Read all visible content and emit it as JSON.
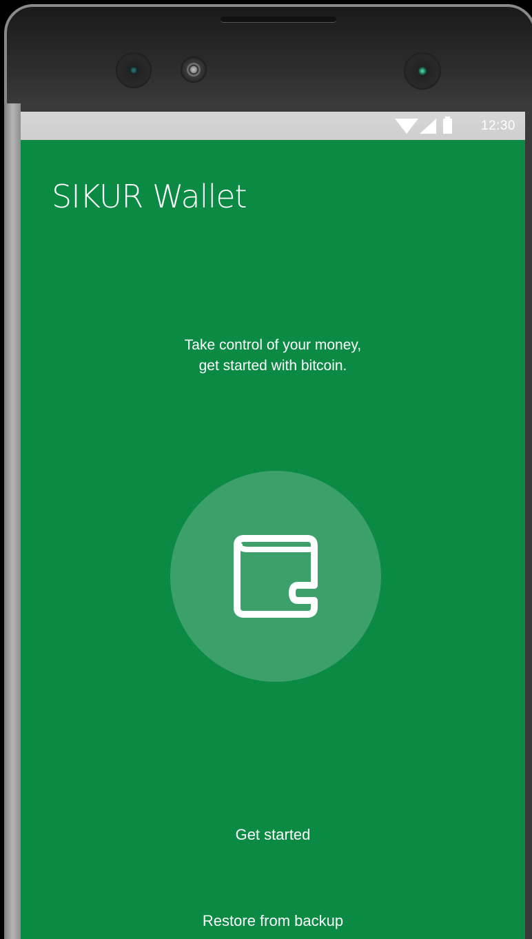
{
  "status_bar": {
    "time": "12:30",
    "icons": [
      "wifi-icon",
      "signal-icon",
      "battery-icon"
    ]
  },
  "app": {
    "title": "SIKUR Wallet",
    "tagline_line1": "Take control of your money,",
    "tagline_line2": "get started with bitcoin.",
    "hero_icon": "wallet-icon"
  },
  "actions": {
    "get_started": "Get started",
    "restore": "Restore from backup"
  },
  "colors": {
    "background": "#0b8a44",
    "hero_circle": "#3ca06b",
    "text": "#ffffff",
    "status_bar": "#d3d3d3"
  }
}
